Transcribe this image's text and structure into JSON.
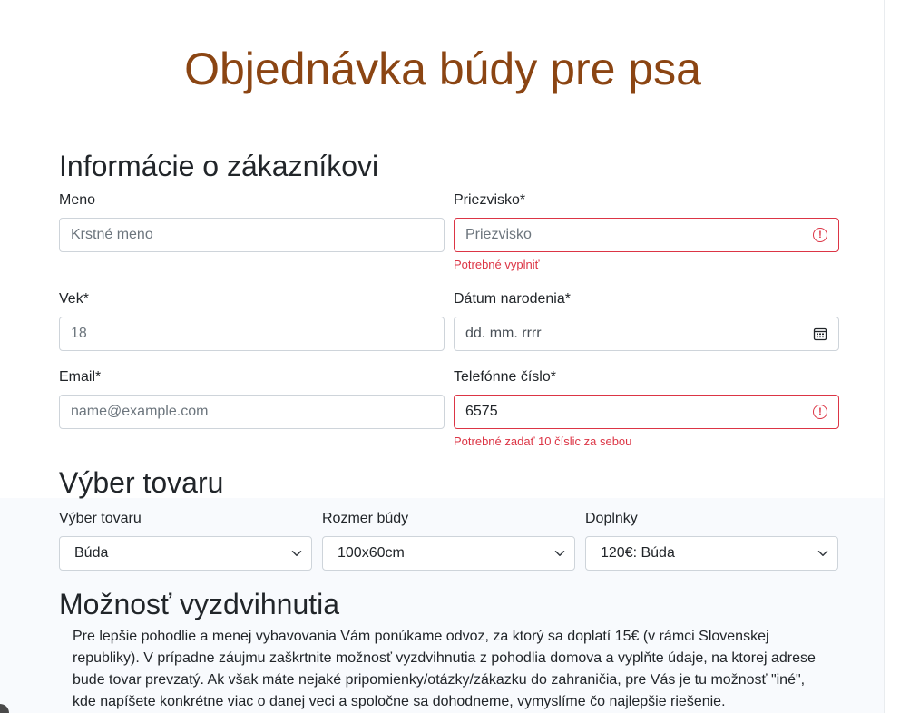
{
  "page": {
    "title": "Objednávka búdy pre psa"
  },
  "customer": {
    "section_title": "Informácie o zákazníkovi",
    "first_name": {
      "label": "Meno",
      "placeholder": "Krstné meno",
      "value": ""
    },
    "last_name": {
      "label": "Priezvisko*",
      "placeholder": "Priezvisko",
      "value": "",
      "error": "Potrebné vyplniť"
    },
    "age": {
      "label": "Vek*",
      "placeholder": "18",
      "value": ""
    },
    "birth_date": {
      "label": "Dátum narodenia*",
      "placeholder": "dd. mm. rrrr",
      "value": ""
    },
    "email": {
      "label": "Email*",
      "placeholder": "name@example.com",
      "value": ""
    },
    "phone": {
      "label": "Telefónne číslo*",
      "placeholder": "",
      "value": "6575",
      "error": "Potrebné zadať 10 číslic za sebou"
    }
  },
  "product": {
    "section_title": "Výber tovaru",
    "type": {
      "label": "Výber tovaru",
      "selected": "Búda"
    },
    "size": {
      "label": "Rozmer búdy",
      "selected": "100x60cm"
    },
    "extras": {
      "label": "Doplnky",
      "selected": "120€: Búda"
    }
  },
  "pickup": {
    "section_title": "Možnosť vyzdvihnutia",
    "description": "Pre lepšie pohodlie a menej vybavovania Vám ponúkame odvoz, za ktorý sa doplatí 15€ (v rámci Slovenskej republiky). V prípadne záujmu zaškrtnite možnosť vyzdvihnutia z pohodlia domova a vyplňte údaje, na ktorej adrese bude tovar prevzatý. Ak však máte nejaké pripomienky/otázky/zákazku do zahraničia, pre Vás je tu možnosť \"iné\", kde napíšete konkrétne viac o danej veci a spoločne sa dohodneme, vymyslíme čo najlepšie riešenie."
  },
  "colors": {
    "title": "#8b4513",
    "error": "#dc3545",
    "border": "#ced4da"
  }
}
